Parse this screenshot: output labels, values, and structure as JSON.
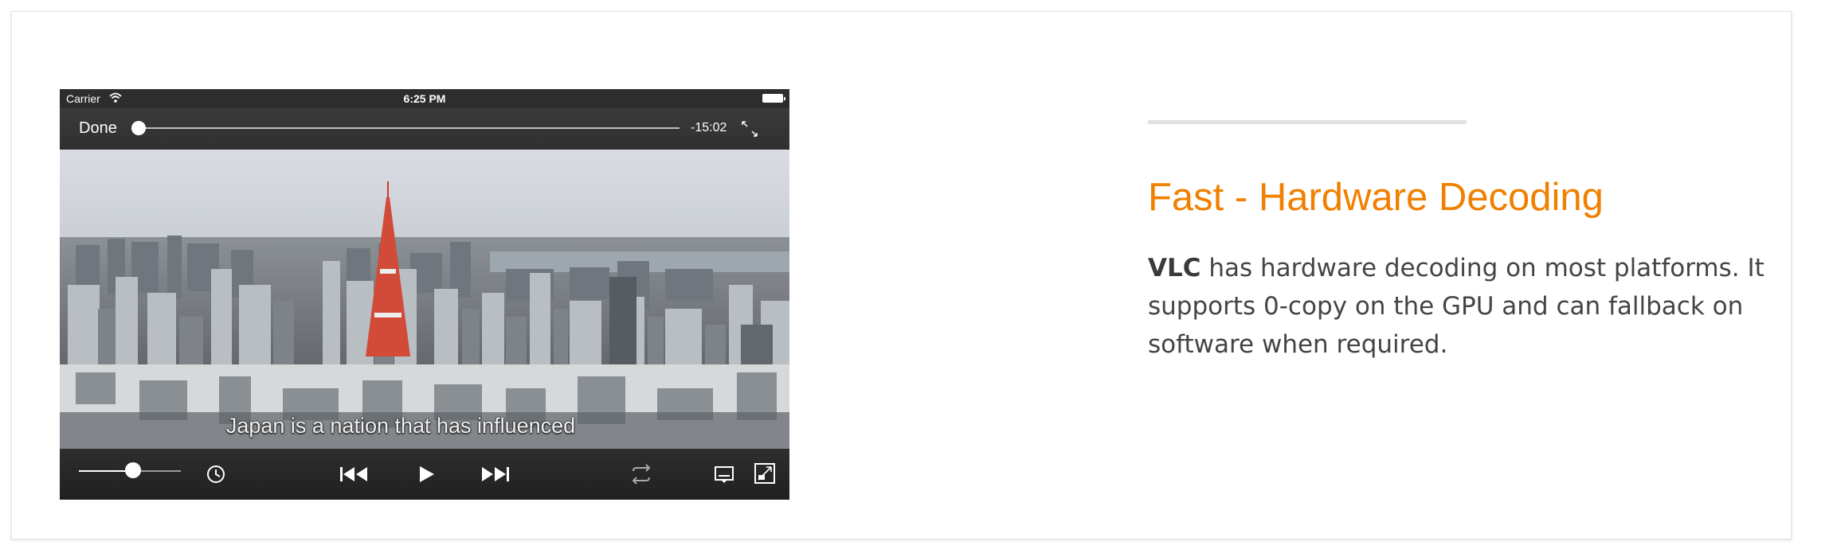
{
  "phone": {
    "status": {
      "carrier": "Carrier",
      "time": "6:25 PM"
    },
    "player": {
      "done_label": "Done",
      "remaining_time": "-15:02",
      "playback_progress": 0.0,
      "volume_level": 0.5,
      "subtitle_text": "Japan is a nation that has influenced"
    },
    "icons": [
      "wifi-icon",
      "battery-icon",
      "expand-icon",
      "clock-icon",
      "skip-back-icon",
      "play-icon",
      "skip-forward-icon",
      "repeat-icon",
      "subtitles-icon",
      "aspect-ratio-icon"
    ]
  },
  "feature": {
    "heading": "Fast - Hardware Decoding",
    "body_bold": "VLC",
    "body_rest": " has hardware decoding on most platforms. It supports 0-copy on the GPU and can fallback on software when required."
  },
  "colors": {
    "heading": "#f08000",
    "body": "#444444",
    "divider": "#e2e2e2"
  }
}
